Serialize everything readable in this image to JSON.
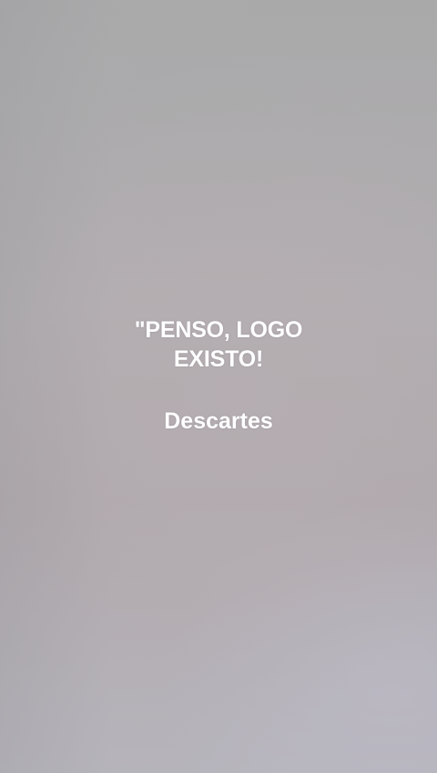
{
  "quote": {
    "line1": "\"PENSO, LOGO",
    "line2": "EXISTO!"
  },
  "author": "Descartes"
}
